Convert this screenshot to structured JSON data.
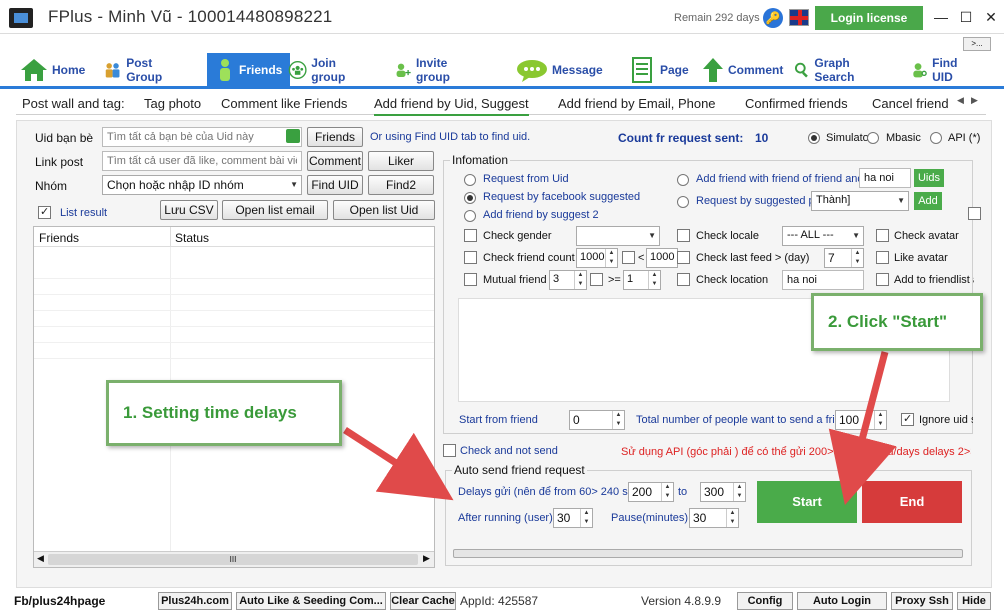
{
  "window": {
    "title": "FPlus - Minh Vũ - 100014480898221",
    "remain": "Remain 292 days",
    "login_label": "Login license",
    "more_label": ">..."
  },
  "nav": [
    {
      "label": "Home",
      "icon": "home-icon"
    },
    {
      "label": "Post Group",
      "icon": "people-icon"
    },
    {
      "label": "Friends",
      "icon": "person-icon"
    },
    {
      "label": "Join group",
      "icon": "group-add-icon"
    },
    {
      "label": "Invite group",
      "icon": "person-add-icon"
    },
    {
      "label": "Message",
      "icon": "chat-icon"
    },
    {
      "label": "Page",
      "icon": "document-icon"
    },
    {
      "label": "Comment",
      "icon": "arrow-up-icon"
    },
    {
      "label": "Graph Search",
      "icon": "search-icon"
    },
    {
      "label": "Find UID",
      "icon": "person-search-icon"
    }
  ],
  "subtabs": [
    "Post wall and tag:",
    "Tag photo",
    "Comment like Friends",
    "Add friend by Uid, Suggest",
    "Add friend by Email, Phone",
    "Confirmed friends",
    "Cancel friend"
  ],
  "left": {
    "uid_label": "Uid bạn bè",
    "uid_placeholder": "Tìm tất cả bạn bè của Uid này",
    "friends_btn": "Friends",
    "find_hint": "Or using Find UID tab to find uid.",
    "link_label": "Link post",
    "link_placeholder": "Tìm tất cả user đã like, comment bài viết",
    "comment_btn": "Comment",
    "liker_btn": "Liker",
    "group_label": "Nhóm",
    "group_value": "Chọn hoặc nhập ID nhóm",
    "finduid_btn": "Find UID",
    "find2_btn": "Find2",
    "list_result": "List result",
    "save_csv": "Lưu CSV",
    "open_email": "Open list email",
    "open_uid": "Open list Uid",
    "grid_cols": [
      "Friends",
      "Status"
    ],
    "scroll_mark": "III"
  },
  "right": {
    "count_label": "Count fr request sent:",
    "count_value": "10",
    "mode_simulator": "Simulator",
    "mode_mbasic": "Mbasic",
    "mode_api": "API (*)",
    "info_title": "Infomation",
    "r_uid": "Request from Uid",
    "r_fb": "Request by facebook suggested",
    "r_s2": "Add friend by suggest 2",
    "r_fof": "Add friend with friend of friend and",
    "fof_value": "ha noi",
    "uids_btn": "Uids",
    "r_place": "Request by suggested place",
    "place_value": "Thành]",
    "add_btn": "Add",
    "check_gender": "Check gender",
    "check_locale": "Check locale",
    "locale_value": "--- ALL ---",
    "check_avatar": "Check avatar",
    "check_count": "Check friend count",
    "count_min": "1000",
    "count_lt": "<",
    "count_max": "1000",
    "check_feed": "Check last feed > (day)",
    "feed_value": "7",
    "like_avatar": "Like avatar",
    "mutual": "Mutual friend <",
    "mutual_value": "3",
    "mutual_ge": ">=",
    "mutual_min": "1",
    "check_location": "Check location",
    "location_value": "ha noi",
    "add_list": "Add to friendlist a",
    "start_from": "Start from friend",
    "start_value": "0",
    "total_label": "Total number of people want to send a frie",
    "total_value": "100",
    "ignore_uid": "Ignore uid s",
    "check_not_send": "Check and not send",
    "api_note": "Sử dụng API (góc phải ) để có thể gửi 200>500 yêu cầu/days delays 2>3s",
    "auto_title": "Auto send friend request",
    "delay_label": "Delays gửi (nên để from 60> 240 s)",
    "delay_from": "200",
    "delay_to_label": "to",
    "delay_to": "300",
    "after_label": "After running (user)",
    "after_value": "30",
    "pause_label": "Pause(minutes)",
    "pause_value": "30",
    "start_btn": "Start",
    "end_btn": "End"
  },
  "callouts": {
    "one": "1. Setting time delays",
    "two": "2. Click \"Start\""
  },
  "footer": {
    "fanpage": "Fb/plus24hpage",
    "btn1": "Plus24h.com",
    "btn2": "Auto Like & Seeding Com...",
    "btn3": "Clear Cache",
    "appid": "AppId: 425587",
    "version": "Version 4.8.9.9",
    "config": "Config",
    "autologin": "Auto Login",
    "proxy": "Proxy Ssh",
    "hide": "Hide"
  },
  "colors": {
    "nav_blue": "#2a7bd8",
    "green": "#4aab4a",
    "red": "#d63b3b",
    "callout_border": "#7ab06c"
  }
}
